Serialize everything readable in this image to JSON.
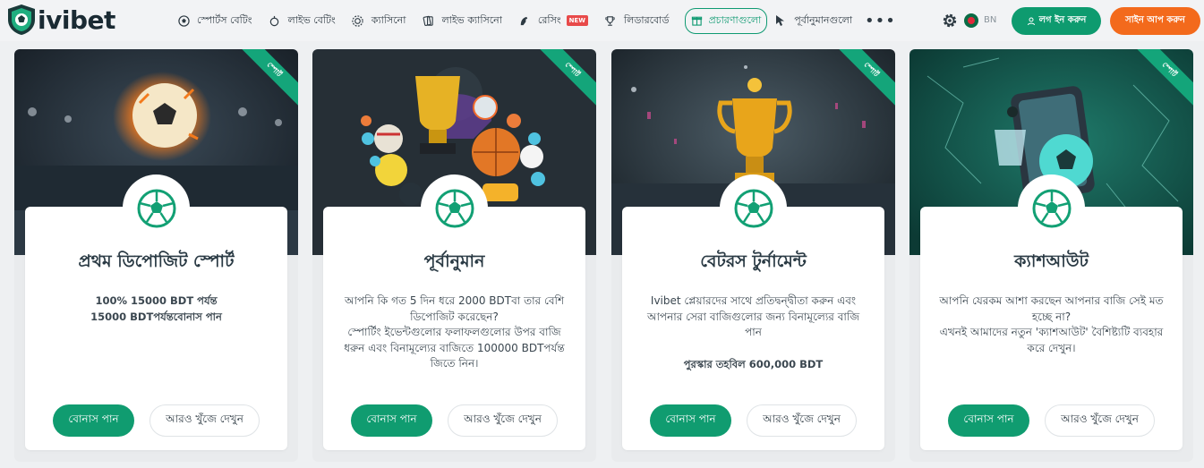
{
  "brand": {
    "name": "ivibet"
  },
  "nav": [
    {
      "label": "স্পোর্টস বেটিং",
      "icon": "soccer-ball-icon"
    },
    {
      "label": "লাইভ বেটিং",
      "icon": "live-icon"
    },
    {
      "label": "ক্যাসিনো",
      "icon": "casino-chip-icon"
    },
    {
      "label": "লাইভ ক্যাসিনো",
      "icon": "cards-icon"
    },
    {
      "label": "রেসিং",
      "icon": "horse-icon",
      "badge": "NEW"
    },
    {
      "label": "লিডারবোর্ড",
      "icon": "trophy-icon"
    },
    {
      "label": "প্রচারণাগুলো",
      "icon": "gift-icon"
    },
    {
      "label": "পূর্বানুমানগুলো",
      "icon": "cursor-icon"
    }
  ],
  "header": {
    "more": "•••",
    "lang": "BN",
    "login": "লগ ইন করুন",
    "signup": "সাইন আপ করুন"
  },
  "colors": {
    "accent": "#0e9b6f",
    "signup": "#f36a1c"
  },
  "cards": [
    {
      "ribbon": "স্পোর্ট",
      "title": "প্রথম ডিপোজিট স্পোর্ট",
      "desc": [
        "100% 15000 BDT পর্যন্ত",
        "15000 BDTপর্যন্তবোনাস পান"
      ],
      "bonus_btn": "বোনাস পান",
      "more_btn": "আরও খুঁজে দেখুন"
    },
    {
      "ribbon": "স্পোর্ট",
      "title": "পূর্বানুমান",
      "desc": [
        "আপনি কি গত 5 দিন ধরে 2000 BDTবা তার বেশি ডিপোজিট করেছেন?",
        "স্পোর্টিং ইভেন্টগুলোর ফলাফলগুলোর উপর বাজি ধরুন এবং বিনামূল্যের বাজিতে 100000 BDTপর্যন্ত জিতে নিন।"
      ],
      "bonus_btn": "বোনাস পান",
      "more_btn": "আরও খুঁজে দেখুন"
    },
    {
      "ribbon": "স্পোর্ট",
      "title": "বেটরস টুর্নামেন্ট",
      "desc": [
        "Ivibet প্লেয়ারদের সাথে প্রতিদ্বন্দ্বীতা করুন এবং আপনার সেরা বাজিগুলোর জন্য বিনামূল্যের বাজি পান"
      ],
      "prize": "পুরস্কার তহবিল  600,000 BDT",
      "bonus_btn": "বোনাস পান",
      "more_btn": "আরও খুঁজে দেখুন"
    },
    {
      "ribbon": "স্পোর্ট",
      "title": "ক্যাশআউট",
      "desc": [
        "আপনি যেরকম আশা করছেন আপনার বাজি সেই মত হচ্ছে না?",
        "এখনই আমাদের নতুন 'ক্যাশআউট' বৈশিষ্ট্যটি ব্যবহার করে দেখুন।"
      ],
      "bonus_btn": "বোনাস পান",
      "more_btn": "আরও খুঁজে দেখুন"
    }
  ]
}
